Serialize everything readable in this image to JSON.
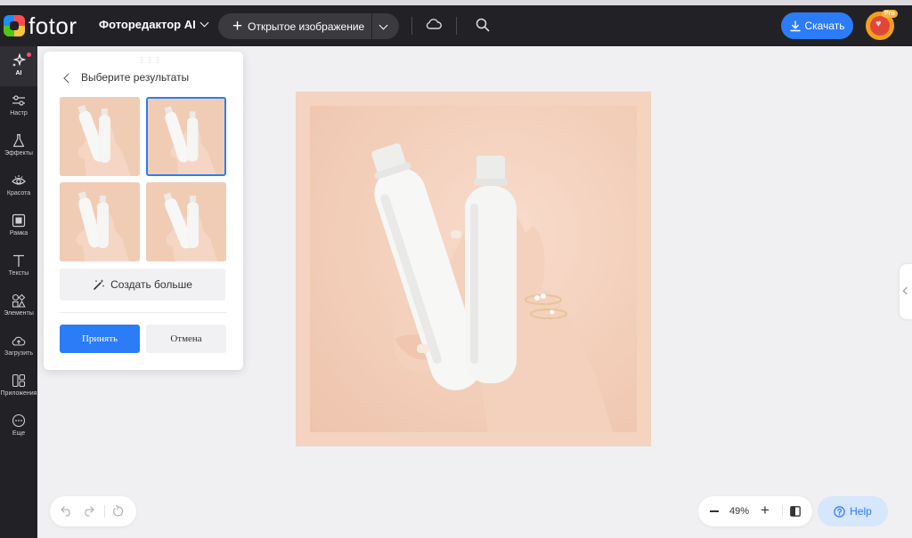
{
  "app": {
    "logo_text": "fotor",
    "editor_mode": "Фоторедактор AI"
  },
  "header": {
    "open_image_label": "Открытое изображение",
    "download_label": "Скачать",
    "pro_badge": "Pro",
    "accent_color": "#2b7cf6"
  },
  "sidebar": {
    "items": [
      {
        "label": "AI",
        "icon": "sparkle-icon"
      },
      {
        "label": "Настр",
        "icon": "sliders-icon"
      },
      {
        "label": "Эффекты",
        "icon": "flask-icon"
      },
      {
        "label": "Красота",
        "icon": "eye-icon"
      },
      {
        "label": "Рамка",
        "icon": "frame-icon"
      },
      {
        "label": "Тексты",
        "icon": "text-icon"
      },
      {
        "label": "Элементы",
        "icon": "shapes-icon"
      },
      {
        "label": "Загрузить",
        "icon": "upload-icon"
      },
      {
        "label": "Приложения",
        "icon": "apps-icon"
      },
      {
        "label": "Еще",
        "icon": "more-icon"
      }
    ]
  },
  "panel": {
    "title": "Выберите результаты",
    "generate_more_label": "Создать больше",
    "accept_label": "Принять",
    "cancel_label": "Отмена",
    "selected_index": 1
  },
  "bottom": {
    "zoom_value": "49%",
    "help_label": "Help"
  }
}
